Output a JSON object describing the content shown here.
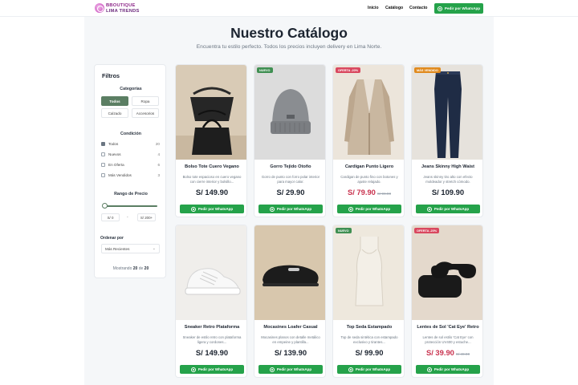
{
  "brand": {
    "line1": "BBOUTIQUE",
    "line2": "LIMA TRENDS"
  },
  "nav": {
    "home": "Inicio",
    "catalog": "Catálogo",
    "contact": "Contacto",
    "whatsapp_cta": "Pedir por WhatsApp"
  },
  "hero": {
    "title": "Nuestro Catálogo",
    "subtitle": "Encuentra tu estilo perfecto. Todos los precios incluyen delivery en Lima Norte."
  },
  "filters": {
    "title": "Filtros",
    "categories_title": "Categorías",
    "categories": [
      {
        "label": "Todos",
        "active": true
      },
      {
        "label": "Ropa",
        "active": false
      },
      {
        "label": "Calzado",
        "active": false
      },
      {
        "label": "Accesorios",
        "active": false
      }
    ],
    "condition_title": "Condición",
    "conditions": [
      {
        "label": "Todos",
        "count": "20",
        "checked": true
      },
      {
        "label": "Nuevos",
        "count": "4",
        "checked": false
      },
      {
        "label": "En Oferta",
        "count": "6",
        "checked": false
      },
      {
        "label": "Más Vendidos",
        "count": "3",
        "checked": false
      }
    ],
    "price_title": "Rango de Precio",
    "price_min": "S/ 0",
    "price_max": "S/ 200+",
    "price_dash": "-",
    "order_label": "Ordenar por",
    "order_value": "Más Recientes",
    "showing_prefix": "Mostrando",
    "showing_count": "20",
    "showing_of": "de",
    "showing_total": "20"
  },
  "products": [
    {
      "name": "Bolso Tote Cuero Vegano",
      "desc": "Bolso tote espacioso en cuero vegano con cierre interior y bolsillo...",
      "price": "S/ 149.90",
      "old_price": "",
      "tag": "",
      "tag_color": "",
      "img": "tote"
    },
    {
      "name": "Gorro Tejido Otoño",
      "desc": "Gorro de punto con forro polar interior para mayor calor.",
      "price": "S/ 29.90",
      "old_price": "",
      "tag": "NUEVO",
      "tag_color": "#3f8f52",
      "img": "beanie"
    },
    {
      "name": "Cardigan Punto Ligero",
      "desc": "Cardigan de punto fino con botones y ajuste relajado.",
      "price": "S/ 79.90",
      "old_price": "S/ 99.90",
      "tag": "OFERTA -20%",
      "tag_color": "#d9485f",
      "img": "cardigan"
    },
    {
      "name": "Jeans Skinny High Waist",
      "desc": "Jeans skinny tiro alto con efecto moldeador y stretch cómodo.",
      "price": "S/ 109.90",
      "old_price": "",
      "tag": "MÁS VENDIDO",
      "tag_color": "#e08a1e",
      "img": "jeans"
    },
    {
      "name": "Sneaker Retro Plataforma",
      "desc": "Sneaker de estilo retro con plataforma ligera y cordones...",
      "price": "S/ 149.90",
      "old_price": "",
      "tag": "",
      "tag_color": "",
      "img": "sneaker"
    },
    {
      "name": "Mocasines Loafer Casual",
      "desc": "Mocasines planos con detalle metálico en empeine y plantilla...",
      "price": "S/ 139.90",
      "old_price": "",
      "tag": "",
      "tag_color": "",
      "img": "loafer"
    },
    {
      "name": "Top Seda Estampado",
      "desc": "Top de seda sintética con estampado exclusivo y tirantes...",
      "price": "S/ 99.90",
      "old_price": "",
      "tag": "NUEVO",
      "tag_color": "#3f8f52",
      "img": "top"
    },
    {
      "name": "Lentes de Sol 'Cat Eye' Retro",
      "desc": "Lentes de sol estilo 'Cat Eye' con protección UV400 y estuche...",
      "price": "S/ 39.90",
      "old_price": "S/ 49.90",
      "tag": "OFERTA -20%",
      "tag_color": "#d9485f",
      "img": "sunglasses"
    }
  ],
  "card_cta": "Pedir por WhatsApp",
  "colors": {
    "primary_green": "#5b7e63",
    "whatsapp": "#25a24a",
    "sale_red": "#c9334f"
  }
}
